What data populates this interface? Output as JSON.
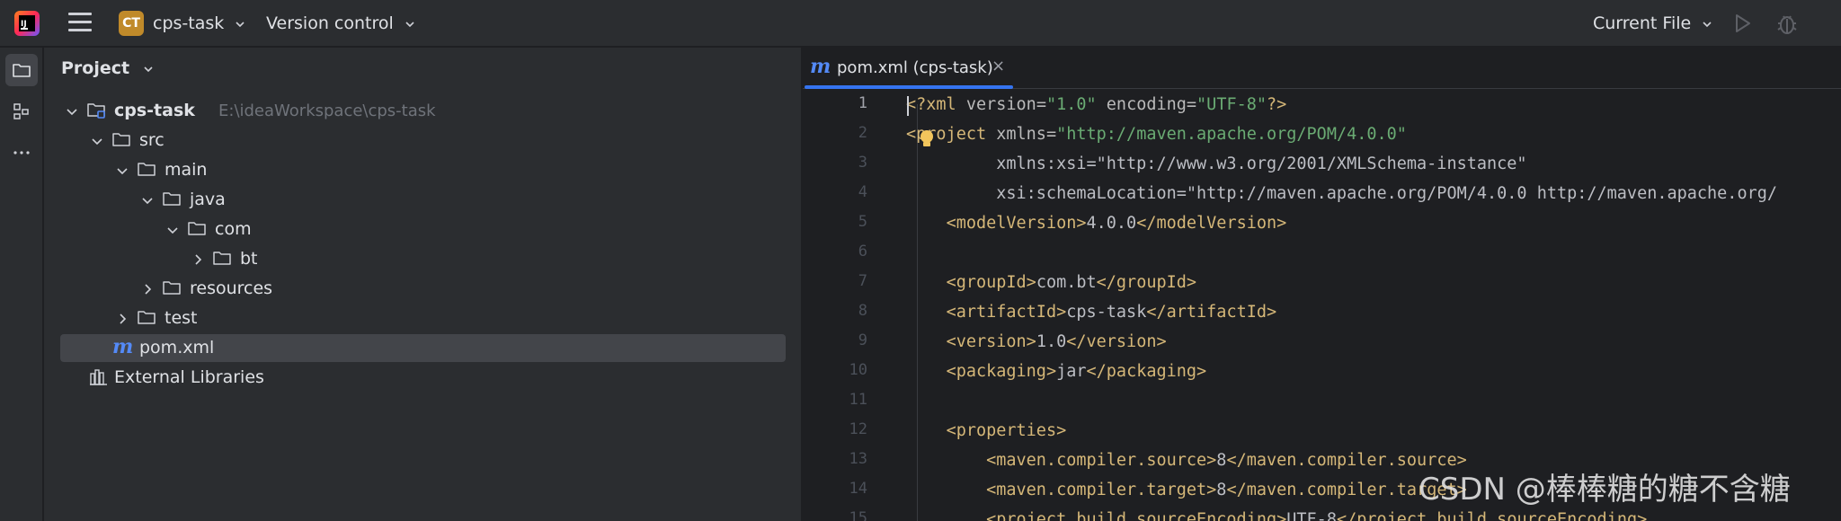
{
  "titlebar": {
    "project_badge": "CT",
    "project_name": "cps-task",
    "version_control": "Version control",
    "run_config": "Current File"
  },
  "toolstrip": {
    "items": [
      "project-icon",
      "structure-icon",
      "more-icon"
    ]
  },
  "project_panel": {
    "title": "Project",
    "tree": [
      {
        "label": "cps-task",
        "path": "E:\\ideaWorkspace\\cps-task",
        "bold": true
      },
      {
        "label": "src"
      },
      {
        "label": "main"
      },
      {
        "label": "java"
      },
      {
        "label": "com"
      },
      {
        "label": "bt"
      },
      {
        "label": "resources"
      },
      {
        "label": "test"
      },
      {
        "label": "pom.xml",
        "selected": true
      },
      {
        "label": "External Libraries"
      }
    ]
  },
  "editor": {
    "tab": {
      "label": "pom.xml (cps-task)",
      "close": "×",
      "icon": "m"
    },
    "current_line": 1,
    "line_numbers": [
      "1",
      "2",
      "3",
      "4",
      "5",
      "6",
      "7",
      "8",
      "9",
      "10",
      "11",
      "12",
      "13",
      "14",
      "15"
    ],
    "lines": [
      "<?xml version=\"1.0\" encoding=\"UTF-8\"?>",
      "<project xmlns=\"http://maven.apache.org/POM/4.0.0\"",
      "         xmlns:xsi=\"http://www.w3.org/2001/XMLSchema-instance\"",
      "         xsi:schemaLocation=\"http://maven.apache.org/POM/4.0.0 http://maven.apache.org/",
      "    <modelVersion>4.0.0</modelVersion>",
      "",
      "    <groupId>com.bt</groupId>",
      "    <artifactId>cps-task</artifactId>",
      "    <version>1.0</version>",
      "    <packaging>jar</packaging>",
      "",
      "    <properties>",
      "        <maven.compiler.source>8</maven.compiler.source>",
      "        <maven.compiler.target>8</maven.compiler.target>",
      "        <project.build.sourceEncoding>UTF-8</project.build.sourceEncoding>"
    ]
  },
  "watermark": "CSDN @棒棒糖的糖不含糖"
}
